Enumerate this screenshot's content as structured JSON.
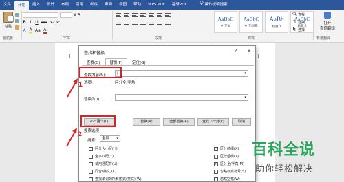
{
  "ribbon_tabs": [
    "文件",
    "开始",
    "插入",
    "设计",
    "布局",
    "引用",
    "邮件",
    "审阅",
    "视图",
    "帮助",
    "WPS PDF",
    "福昕PDF"
  ],
  "active_tab_index": 1,
  "tell_me": "操作说明搜索",
  "clipboard": {
    "paste_label": "粘贴",
    "group_label": "剪贴板"
  },
  "font": {
    "group_label": "字体",
    "format_buttons": [
      "B",
      "I",
      "U",
      "abc",
      "x₂",
      "x²",
      "A",
      "A",
      "Aa",
      "A"
    ]
  },
  "paragraph": {
    "group_label": "段落"
  },
  "styles": {
    "group_label": "样式",
    "items": [
      {
        "sample": "AaBbC",
        "name": "↵ 正文"
      },
      {
        "sample": "AaBbC",
        "name": "↵ 无间隔"
      },
      {
        "sample": "AaBb",
        "name": "标题 1"
      },
      {
        "sample": "AaBbC",
        "name": "标题 2"
      }
    ]
  },
  "editing": {
    "find": "查找",
    "replace": "替换",
    "select": "选择"
  },
  "help_group": {
    "label_line1": "打开",
    "label_line2": "有道翻译",
    "group_label": "有道翻译"
  },
  "dialog": {
    "title": "查找和替换",
    "question": "?",
    "close": "×",
    "tabs": [
      "查找(D)",
      "替换(P)",
      "定位(G)"
    ],
    "active_tab": 1,
    "find_label": "查找内容(N):",
    "find_value": "|",
    "options_label": "选项:",
    "options_value": "区分全/半角",
    "replace_label": "替换为(I):",
    "replace_value": "",
    "less_button": "<< 更少(L)",
    "replace_button": "替换(R)",
    "replace_all_button": "全部替换(A)",
    "find_next_button": "查找下一处(F)",
    "cancel_button": "取消",
    "search_options_title": "搜索选项",
    "search_label": "搜索:",
    "search_value": "全部",
    "checks_left": [
      {
        "label": "区分大小写(H)",
        "checked": false
      },
      {
        "label": "全字匹配(Y)",
        "checked": false
      },
      {
        "label": "使用通配符(U)",
        "checked": false
      },
      {
        "label": "同音(英文)(K)",
        "checked": false
      },
      {
        "label": "查找单词的所有形式(英文)(W)",
        "checked": false
      }
    ],
    "checks_right": [
      {
        "label": "区分前缀(X)",
        "checked": false
      },
      {
        "label": "区分后缀(T)",
        "checked": false
      },
      {
        "label": "区分全/半角(M)",
        "checked": true
      },
      {
        "label": "忽略标点符号(S)",
        "checked": false
      },
      {
        "label": "忽略空格(W)",
        "checked": false
      }
    ]
  },
  "annotations": {
    "step1": "1",
    "step2": "2"
  },
  "watermark": {
    "main": "百科全说",
    "sub": "助你轻松解决"
  },
  "colors": {
    "ribbon_blue": "#2b579a",
    "highlight_red": "#e02020",
    "watermark_green": "#2aa65a"
  }
}
